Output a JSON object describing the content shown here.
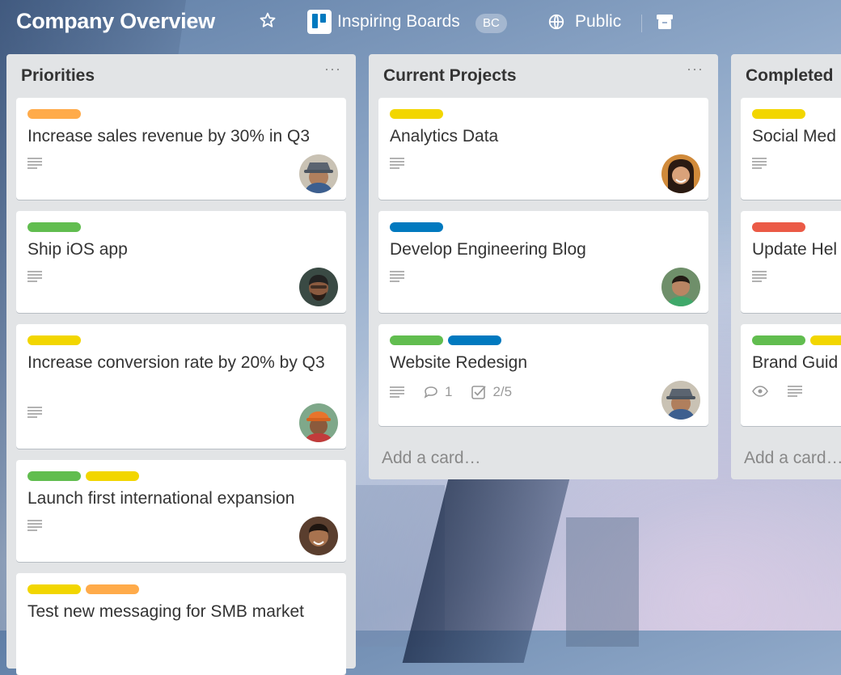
{
  "header": {
    "board_title": "Company Overview",
    "team_name": "Inspiring Boards",
    "team_badge": "BC",
    "visibility": "Public"
  },
  "colors": {
    "orange": "#ffab4a",
    "green": "#61bd4f",
    "yellow": "#f2d600",
    "blue": "#0079bf",
    "red": "#eb5a46"
  },
  "lists": [
    {
      "title": "Priorities",
      "menu": "···",
      "cards": [
        {
          "labels": [
            "orange"
          ],
          "title": "Increase sales revenue by 30% in Q3",
          "avatar": "member-hat"
        },
        {
          "labels": [
            "green"
          ],
          "title": "Ship iOS app",
          "avatar": "member-beard"
        },
        {
          "labels": [
            "yellow"
          ],
          "title": "Increase conversion rate by 20% by Q3",
          "avatar": "member-orange-cap"
        },
        {
          "labels": [
            "green",
            "yellow"
          ],
          "title": "Launch first international expansion",
          "avatar": "member-smile"
        },
        {
          "labels": [
            "yellow",
            "orange"
          ],
          "title": "Test new messaging for SMB market",
          "avatar": ""
        }
      ]
    },
    {
      "title": "Current Projects",
      "menu": "···",
      "add_card": "Add a card…",
      "cards": [
        {
          "labels": [
            "yellow"
          ],
          "title": "Analytics Data",
          "avatar": "member-woman"
        },
        {
          "labels": [
            "blue"
          ],
          "title": "Develop Engineering Blog",
          "avatar": "member-green-shirt"
        },
        {
          "labels": [
            "green",
            "blue"
          ],
          "title": "Website Redesign",
          "comments": "1",
          "checklist": "2/5",
          "avatar": "member-hat"
        }
      ]
    },
    {
      "title": "Completed",
      "add_card": "Add a card…",
      "cards": [
        {
          "labels": [
            "yellow"
          ],
          "title": "Social Med"
        },
        {
          "labels": [
            "red"
          ],
          "title": "Update Hel"
        },
        {
          "labels": [
            "green",
            "yellow"
          ],
          "title": "Brand Guid"
        }
      ]
    }
  ]
}
